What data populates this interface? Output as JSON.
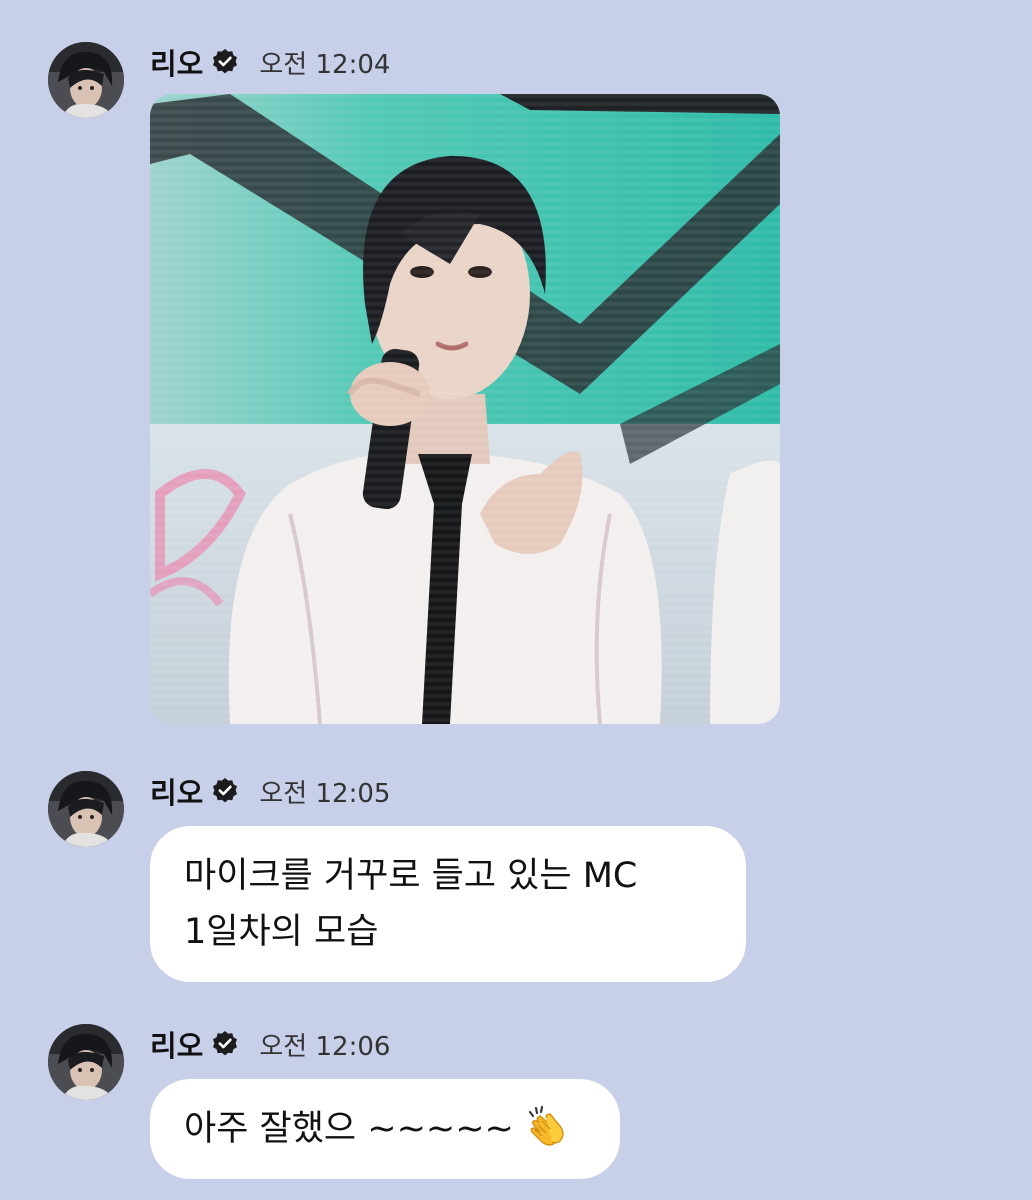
{
  "messages": [
    {
      "sender": "리오",
      "time": "오전 12:04",
      "type": "image"
    },
    {
      "sender": "리오",
      "time": "오전 12:05",
      "type": "text",
      "lines": [
        "마이크를 거꾸로 들고 있는 MC",
        "1일차의 모습"
      ]
    },
    {
      "sender": "리오",
      "time": "오전 12:06",
      "type": "text",
      "text": "아주 잘했으 ~~~~~",
      "emoji_icon": "clapping-hands-icon"
    }
  ],
  "icons": {
    "verified": "verified-badge-icon",
    "avatar": "profile-avatar"
  },
  "colors": {
    "background": "#c8cfe8",
    "bubble": "#ffffff",
    "screen_teal": "#37c1ad"
  }
}
